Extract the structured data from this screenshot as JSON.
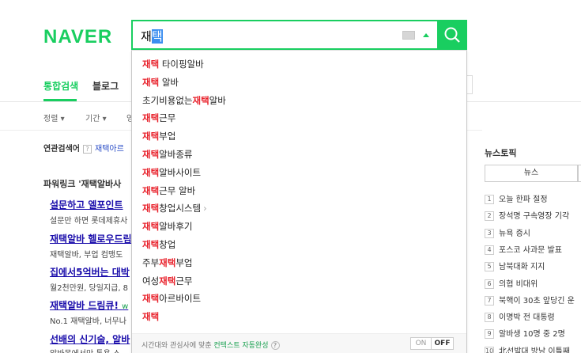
{
  "logo": "NAVER",
  "search": {
    "typed": "재",
    "selected": "택"
  },
  "tabs": [
    {
      "label": "통합검색",
      "active": true
    },
    {
      "label": "블로그",
      "active": false
    }
  ],
  "filters": [
    "정렬 ▾",
    "기간 ▾",
    "영"
  ],
  "related": {
    "label": "연관검색어",
    "help": "?",
    "first": "재택아르"
  },
  "power_link": "파워링크 '재택알바사",
  "ads": [
    {
      "title": "설문하고 엘포인트",
      "desc": "설문만 하면 롯데제휴사"
    },
    {
      "title": "재택알바 헬로우드림",
      "desc": "재택알바, 부업 컴맹도"
    },
    {
      "title": "집에서5억버는 대박",
      "desc": "월2천만원, 당일지급, 8"
    },
    {
      "title": "재택알바 드림큐!",
      "tail": "w",
      "desc": "No.1 재택알바, 너무나"
    },
    {
      "title": "선배의 신기술, 알바",
      "desc": "알바몬에서만 통용 스"
    }
  ],
  "news": {
    "title": "뉴스토픽",
    "tab": "뉴스",
    "items": [
      {
        "num": "1",
        "text": "오늘 한파 절정"
      },
      {
        "num": "2",
        "text": "장석명 구속영장 기각"
      },
      {
        "num": "3",
        "text": "뉴욕 증시"
      },
      {
        "num": "4",
        "text": "포스코 사과문 발표"
      },
      {
        "num": "5",
        "text": "남북대화 지지"
      },
      {
        "num": "6",
        "text": "의협 비대위"
      },
      {
        "num": "7",
        "text": "북핵이 30초 앞당긴 운"
      },
      {
        "num": "8",
        "text": "이명박 전 대통령"
      },
      {
        "num": "9",
        "text": "알바생 10명 중 2명"
      },
      {
        "num": "10",
        "text": "北선발대 방남 이틀째"
      }
    ]
  },
  "autocomplete": {
    "items": [
      {
        "hl": "재택",
        "pre": "",
        "post": " 타이핑알바",
        "chevron": false
      },
      {
        "hl": "재택",
        "pre": "",
        "post": " 알바",
        "chevron": false
      },
      {
        "hl": "재택",
        "pre": "초기비용없는",
        "post": "알바",
        "chevron": false
      },
      {
        "hl": "재택",
        "pre": "",
        "post": "근무",
        "chevron": false
      },
      {
        "hl": "재택",
        "pre": "",
        "post": "부업",
        "chevron": false
      },
      {
        "hl": "재택",
        "pre": "",
        "post": "알바종류",
        "chevron": false
      },
      {
        "hl": "재택",
        "pre": "",
        "post": "알바사이트",
        "chevron": false
      },
      {
        "hl": "재택",
        "pre": "",
        "post": "근무 알바",
        "chevron": false
      },
      {
        "hl": "재택",
        "pre": "",
        "post": "창업시스템",
        "chevron": true
      },
      {
        "hl": "재택",
        "pre": "",
        "post": "알바후기",
        "chevron": false
      },
      {
        "hl": "재택",
        "pre": "",
        "post": "창업",
        "chevron": false
      },
      {
        "hl": "재택",
        "pre": "주부",
        "post": "부업",
        "chevron": false
      },
      {
        "hl": "재택",
        "pre": "여성",
        "post": "근무",
        "chevron": false
      },
      {
        "hl": "재택",
        "pre": "",
        "post": "아르바이트",
        "chevron": false
      },
      {
        "hl": "재택",
        "pre": "",
        "post": "",
        "chevron": false
      }
    ],
    "chevron_glyph": "›",
    "footer": {
      "text": "시간대와 관심사에 맞춘 ",
      "link": "컨텍스트 자동완성",
      "help": "?"
    },
    "toggle_on": "ON",
    "toggle_off": "OFF"
  },
  "colors": {
    "brand": "#19ce60",
    "highlight": "#e8202a",
    "link": "#1a0dab"
  }
}
